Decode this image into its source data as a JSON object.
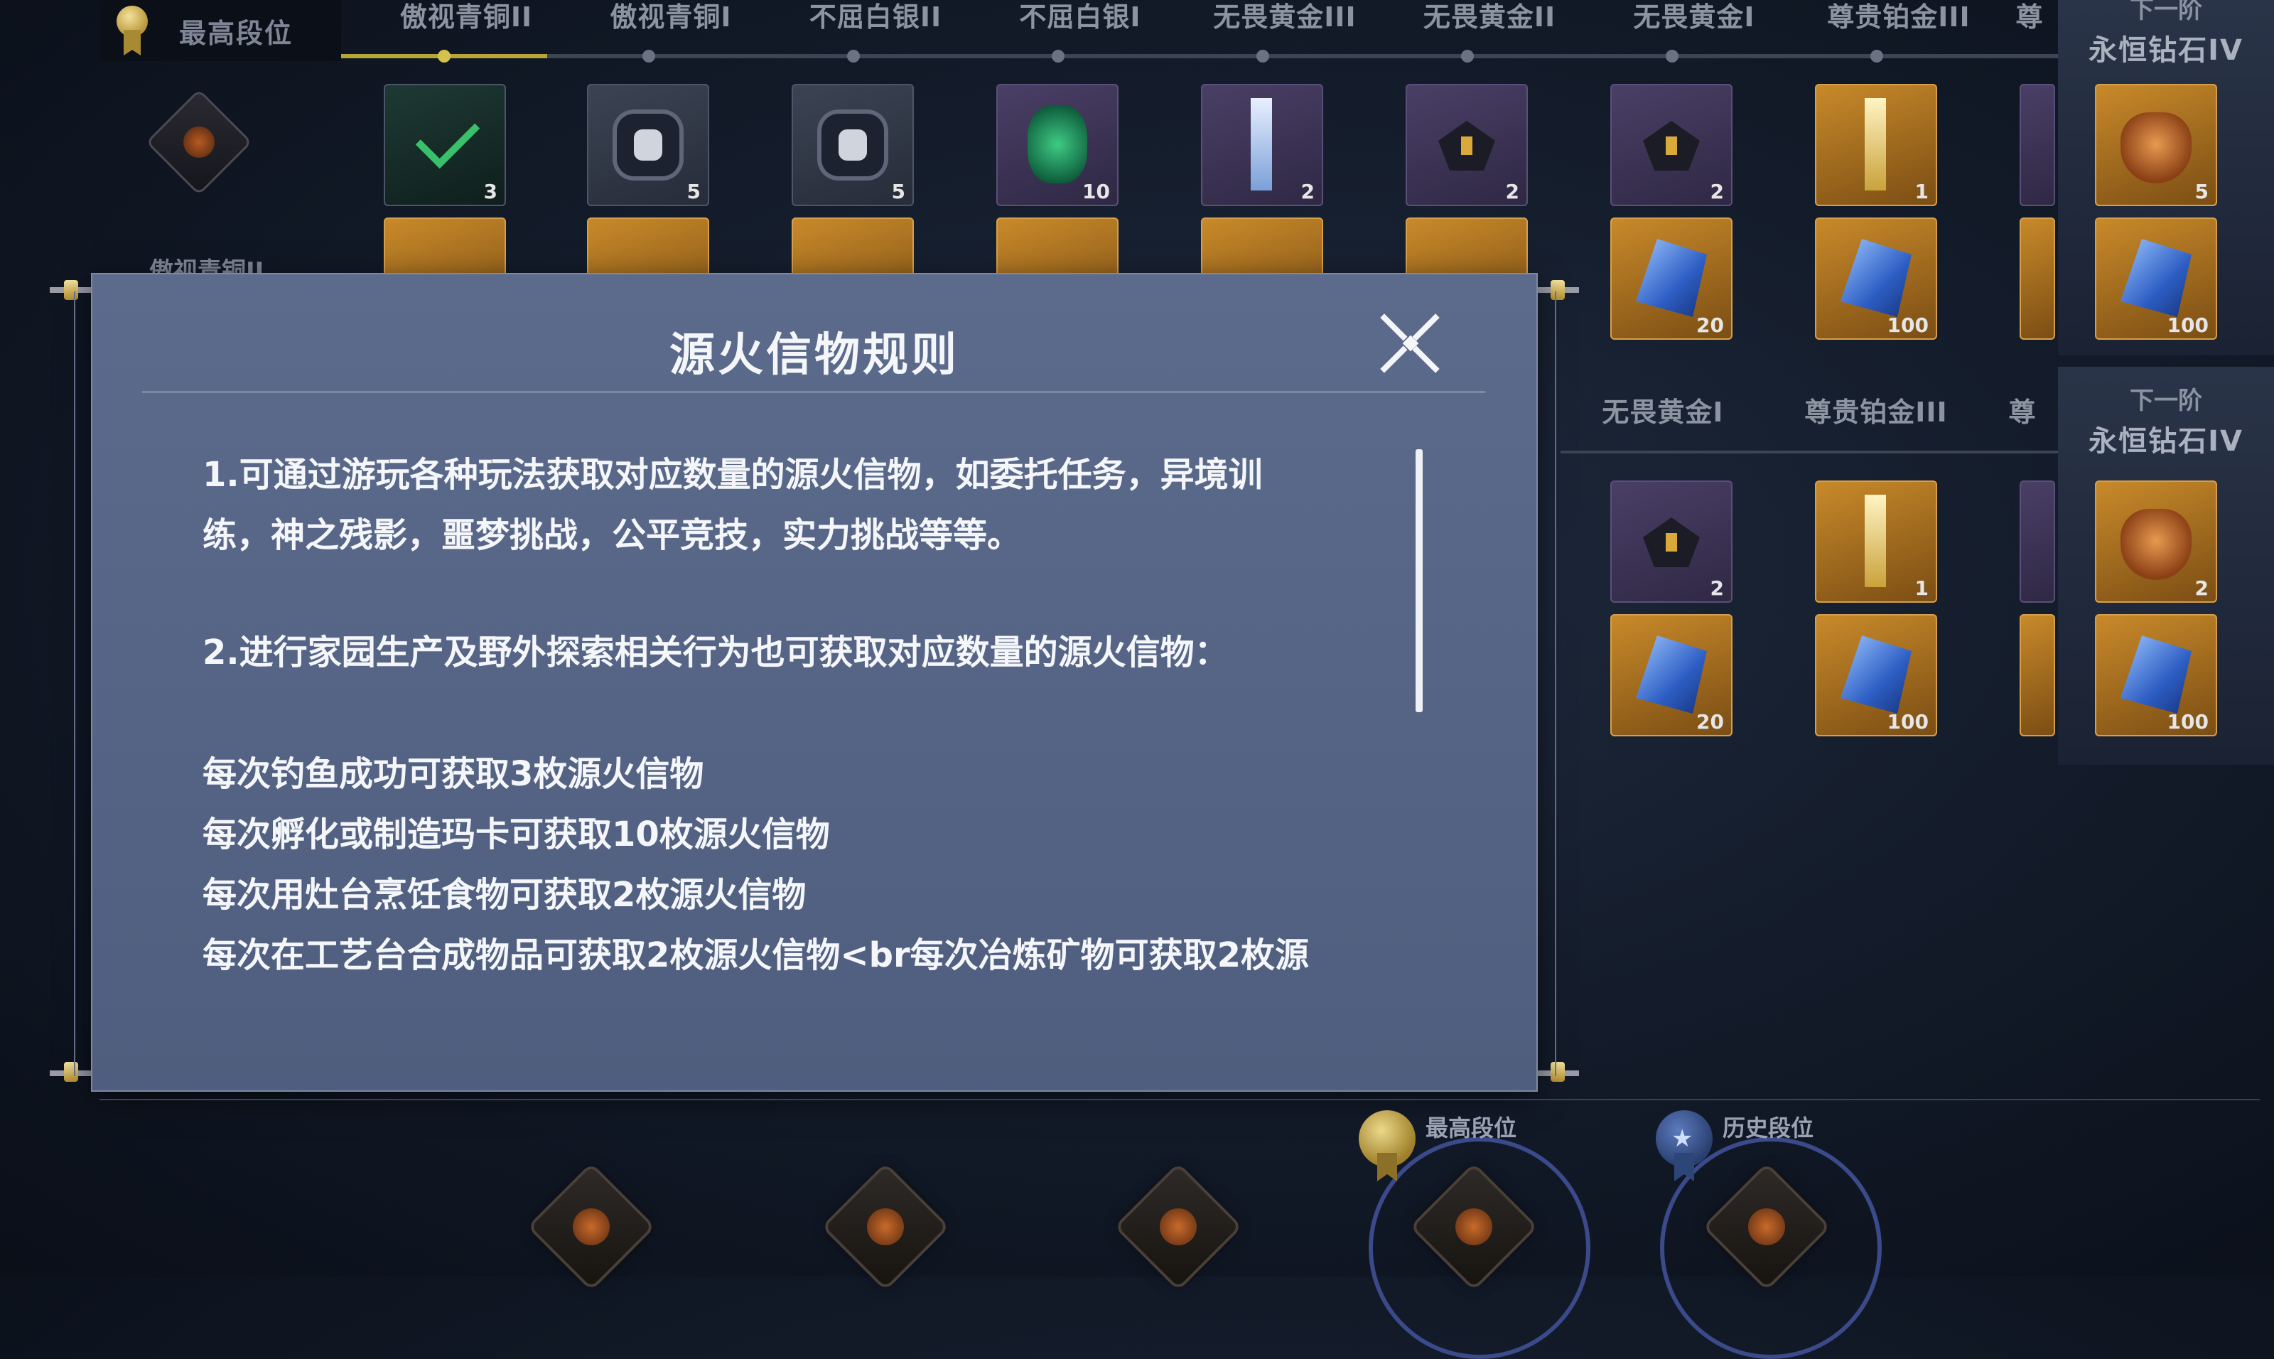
{
  "header": {
    "current_rank_label": "最高段位",
    "tabs": [
      "傲视青铜II",
      "傲视青铜I",
      "不屈白银II",
      "不屈白银I",
      "无畏黄金III",
      "无畏黄金II",
      "无畏黄金I",
      "尊贵铂金III",
      "尊"
    ],
    "progress_completed_tabs": 1
  },
  "next_rank": {
    "top": {
      "sub": "下一阶",
      "title": "永恒钻石IV"
    },
    "mid": {
      "sub": "下一阶",
      "title": "永恒钻石IV"
    }
  },
  "rewards_top": {
    "row1_qty": [
      "3",
      "5",
      "5",
      "10",
      "2",
      "2",
      "2",
      "1",
      "5"
    ],
    "row2_qty": [
      "20",
      "100",
      "100"
    ]
  },
  "rewards_mid": {
    "tabs": [
      "无畏黄金I",
      "尊贵铂金III",
      "尊"
    ],
    "row1_qty": [
      "2",
      "1",
      "2"
    ],
    "row2_qty": [
      "20",
      "100",
      "100"
    ]
  },
  "left_partial_label": "傲视青铜II",
  "dialog": {
    "title": "源火信物规则",
    "close_icon": "close-x-icon",
    "rules": [
      "1.可通过游玩各种玩法获取对应数量的源火信物，如委托任务，异境训",
      "练，神之残影，噩梦挑战，公平竞技，实力挑战等等。",
      "2.进行家园生产及野外探索相关行为也可获取对应数量的源火信物：",
      "每次钓鱼成功可获取3枚源火信物",
      "每次孵化或制造玛卡可获取10枚源火信物",
      "每次用灶台烹饪食物可获取2枚源火信物",
      "每次在工艺台合成物品可获取2枚源火信物<br每次冶炼矿物可获取2枚源"
    ]
  },
  "bottom": {
    "badges": [
      "最高段位",
      "历史段位"
    ]
  },
  "colors": {
    "dialog_bg": "#55647f",
    "gold": "#d4c24a",
    "text": "#f4f6fa"
  }
}
